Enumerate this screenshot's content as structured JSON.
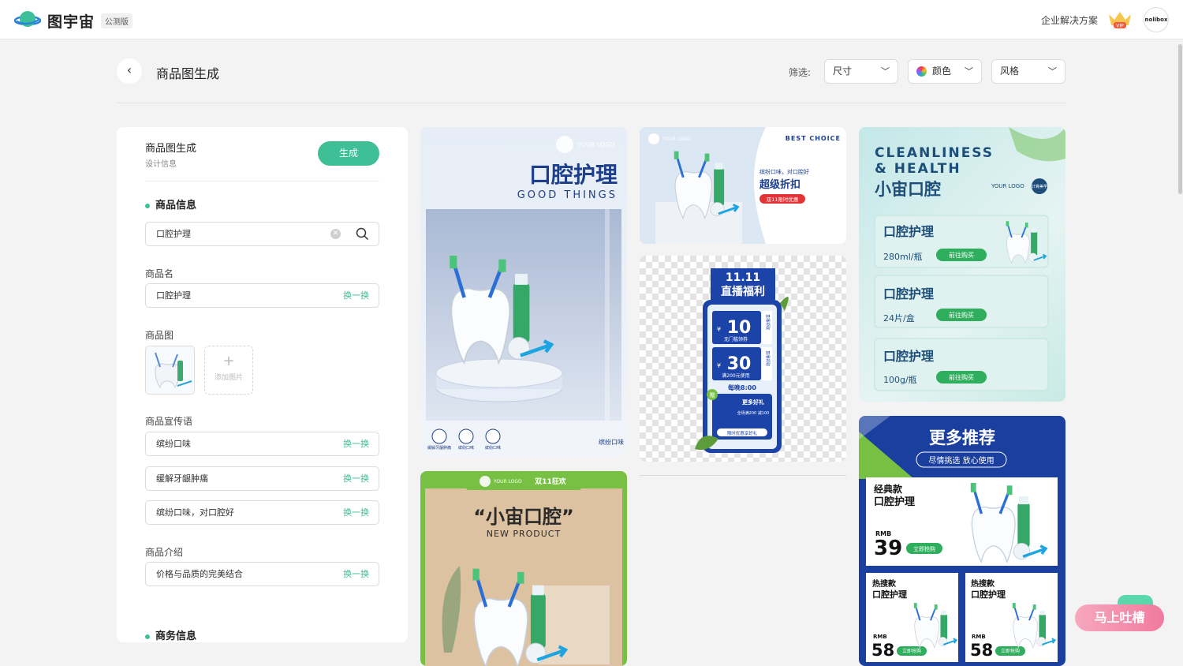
{
  "app": {
    "brand": "图宇宙",
    "beta_badge": "公测版",
    "enterprise_link": "企业解决方案",
    "vip_label": "VIP",
    "avatar_text": "nolibox"
  },
  "page": {
    "title": "商品图生成",
    "filter_label": "筛选:"
  },
  "filters": [
    {
      "label": "尺寸"
    },
    {
      "label": "颜色"
    },
    {
      "label": "风格"
    }
  ],
  "panel": {
    "title": "商品图生成",
    "subtitle": "设计信息",
    "generate_label": "生成",
    "product_info_heading": "商品信息",
    "search_value": "口腔护理",
    "name_label": "商品名",
    "name_value": "口腔护理",
    "swap_label": "换一换",
    "image_label": "商品图",
    "add_image_label": "添加图片",
    "slogan_label": "商品宣传语",
    "slogans": [
      "缤纷口味",
      "缓解牙龈肿痛",
      "缤纷口味，对口腔好"
    ],
    "intro_label": "商品介绍",
    "intro_value": "价格与品质的完美结合",
    "business_heading": "商务信息"
  },
  "cards": {
    "c1": {
      "logo": "YOUR LOGO",
      "title": "口腔护理",
      "subtitle": "GOOD THINGS",
      "icon_labels": [
        "缓解牙龈肿痛",
        "缤纷口味",
        "缤纷口味"
      ],
      "footer": "缤纷口味"
    },
    "c2": {
      "logo": "YOUR LOGO",
      "tag": "双11狂欢",
      "title": "“小宙口腔”",
      "subtitle": "NEW PRODUCT"
    },
    "c3": {
      "logo": "YOUR LOGO",
      "badge": "BEST CHOICE",
      "line1": "缤纷口味，对口腔好",
      "title": "超级折扣",
      "pill": "双11限时优惠"
    },
    "c4": {
      "date": "11.11",
      "title": "直播福利",
      "coupon1_value": "10",
      "coupon1_currency": "¥",
      "coupon1_note": "无门槛领券",
      "coupon_side": "直播领取",
      "coupon2_value": "30",
      "coupon2_currency": "¥",
      "coupon2_note": "满200元使用",
      "time": "每晚8:00",
      "gift_tag": "赠",
      "gift_title": "更多好礼",
      "gift_note": "全场满200 减100",
      "gift_footer": "限时优惠享好礼"
    },
    "c5": {
      "headline1": "CLEANLINESS",
      "headline2": "& HEALTH",
      "title": "小宙口腔",
      "logo": "YOUR LOGO",
      "logo_badge": "计算美学",
      "buy_label": "前往购买",
      "items": [
        {
          "name": "口腔护理",
          "spec": "280ml/瓶"
        },
        {
          "name": "口腔护理",
          "spec": "24片/盒"
        },
        {
          "name": "口腔护理",
          "spec": "100g/瓶"
        }
      ]
    },
    "c6": {
      "title": "更多推荐",
      "subtitle": "尽情挑选 放心使用",
      "rmb": "RMB",
      "buy_label": "立即抢购",
      "main": {
        "tag": "经典款",
        "name": "口腔护理",
        "price": "39"
      },
      "small": [
        {
          "tag": "热搜款",
          "name": "口腔护理",
          "price": "58"
        },
        {
          "tag": "热搜款",
          "name": "口腔护理",
          "price": "58"
        }
      ]
    }
  },
  "feedback_label": "马上吐槽",
  "colors": {
    "accent": "#3fbf96",
    "navy": "#1b3f9f",
    "lime": "#78c043"
  }
}
